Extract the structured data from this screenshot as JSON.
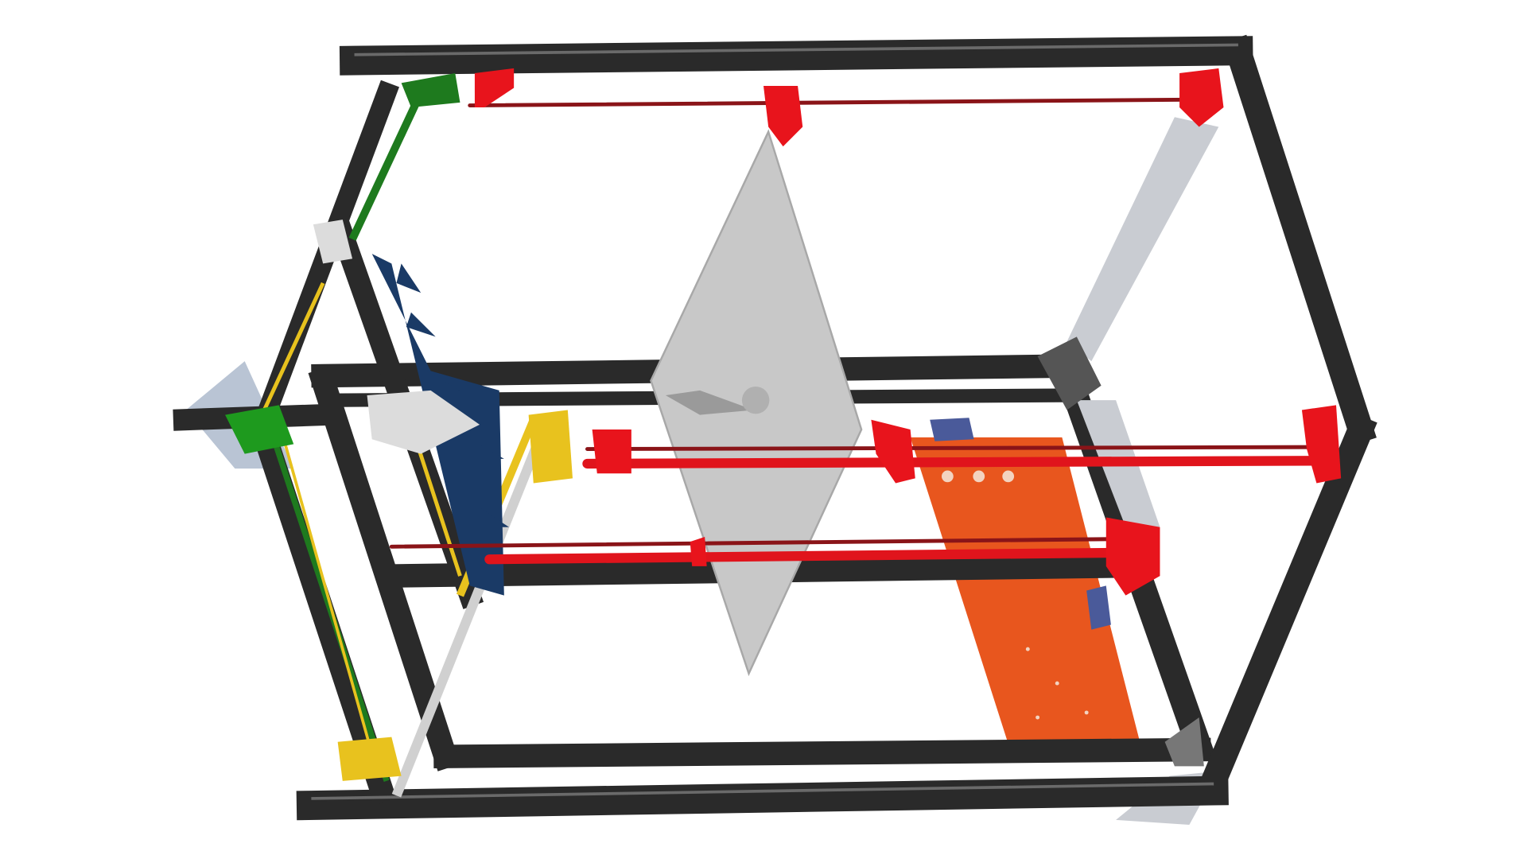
{
  "colors": {
    "background": "#ffffff",
    "frame": "#2a2a2a",
    "frame_highlight": "#5a5a5a",
    "rod_red": "#e0141c",
    "bracket_red": "#e8141c",
    "plate_grey": "#c8c8c8",
    "bed_orange": "#e8561e",
    "absorber_blue": "#1a3a66",
    "rail_yellow": "#e8c21e",
    "rail_green": "#1e7a1e",
    "aluminium": "#c9ccd2"
  }
}
